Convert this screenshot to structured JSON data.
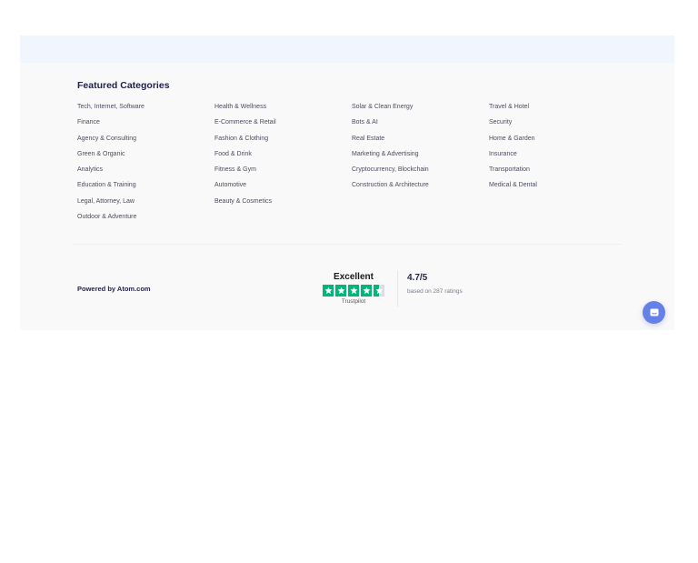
{
  "featured": {
    "title": "Featured Categories",
    "columns": [
      [
        "Tech, Internet, Software",
        "Finance",
        "Agency & Consulting",
        "Green & Organic",
        "Analytics",
        "Education & Training",
        "Legal, Attorney, Law",
        "Outdoor & Adventure"
      ],
      [
        "Health & Wellness",
        "E-Commerce & Retail",
        "Fashion & Clothing",
        "Food & Drink",
        "Fitness & Gym",
        "Automotive",
        "Beauty & Cosmetics"
      ],
      [
        "Solar & Clean Energy",
        "Bots & AI",
        "Real Estate",
        "Marketing & Advertising",
        "Cryptocurrency, Blockchain",
        "Construction & Architecture"
      ],
      [
        "Travel & Hotel",
        "Security",
        "Home & Garden",
        "Insurance",
        "Transportation",
        "Medical & Dental"
      ]
    ]
  },
  "footer": {
    "powered_by": "Powered by Atom.com"
  },
  "trustpilot": {
    "label": "Excellent",
    "brand": "Trustpilot",
    "stars_filled": 4.5,
    "stars_total": 5,
    "star_color": "#00b67a"
  },
  "rating": {
    "score": "4.7/5",
    "subtext": "based on 287 ratings"
  },
  "chat": {
    "icon": "chat-bubble-icon",
    "color": "#6580e6"
  }
}
